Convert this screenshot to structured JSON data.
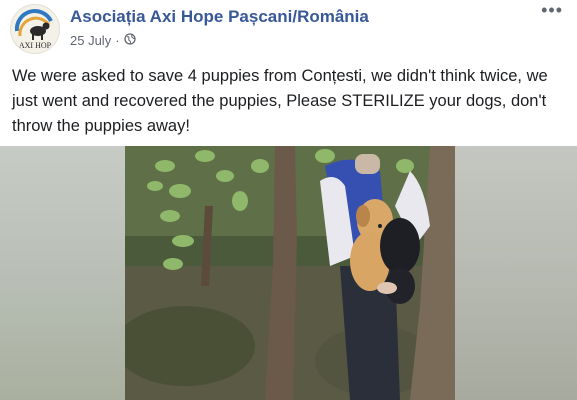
{
  "post": {
    "page_name": "Asociația Axi Hope Pașcani/România",
    "date": "25 July",
    "separator": "·",
    "privacy_icon": "globe-icon",
    "more_icon": "more-options-icon",
    "avatar_text": "AXI HOP",
    "text": "We were asked to save 4 puppies from Conțesti, we didn't think twice, we just went and recovered the puppies, Please STERILIZE your dogs, don't throw the puppies away!"
  },
  "colors": {
    "page_name": "#385898",
    "meta": "#606770",
    "text": "#1c1e21"
  }
}
